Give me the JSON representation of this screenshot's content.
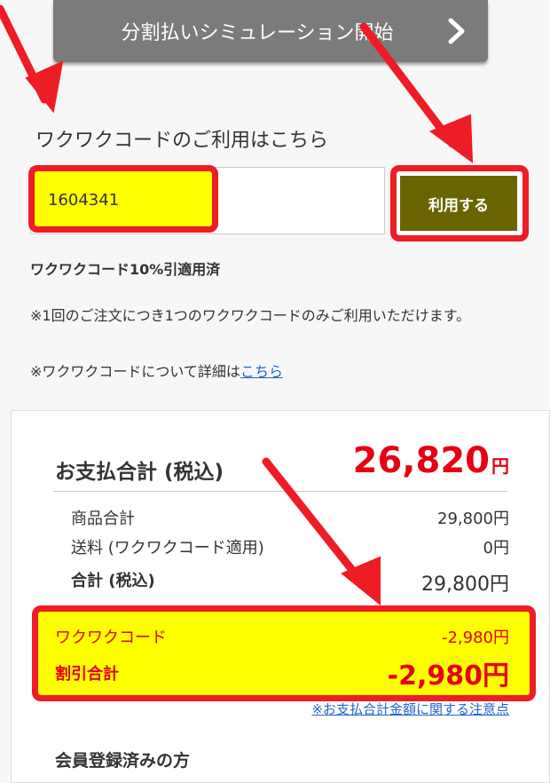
{
  "header": {
    "simulation_button_label": "分割払いシミュレーション開始"
  },
  "coupon": {
    "title": "ワクワクコードのご利用はこちら",
    "input_value": "1604341",
    "apply_button_label": "利用する",
    "applied_text": "ワクワクコード10%引適用済",
    "note_one_per_order": "※1回のご注文につき1つのワクワクコードのみご利用いただけます。",
    "note_details_prefix": "※ワクワクコードについて詳細は",
    "note_details_link": "こちら"
  },
  "summary": {
    "total_label": "お支払合計 (税込)",
    "total_value": "26,820",
    "total_unit": "円",
    "rows": [
      {
        "label": "商品合計",
        "value": "29,800円"
      },
      {
        "label": "送料 (ワクワクコード適用)",
        "value": "0円"
      },
      {
        "label": "合計 (税込)",
        "value": "29,800円"
      }
    ],
    "discount": {
      "code_label": "ワクワクコード",
      "code_value": "-2,980円",
      "total_label": "割引合計",
      "total_value": "-2,980円"
    },
    "details_link": "※お支払合計金額に関する注意点"
  },
  "member": {
    "heading": "会員登録済みの方"
  },
  "colors": {
    "highlight": "#ffff00",
    "annotation_red": "#ee1c25",
    "price_red": "#e60012",
    "apply_button": "#6a6400"
  }
}
